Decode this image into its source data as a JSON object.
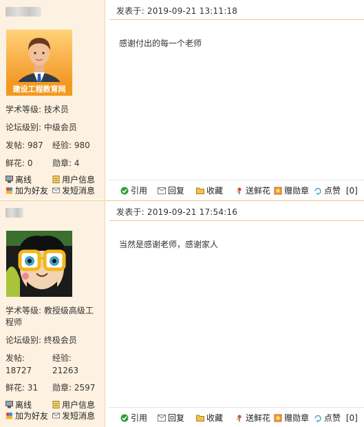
{
  "posts": [
    {
      "username": "",
      "avatar": {
        "caption": "建设工程教育网",
        "icon": "business-man-avatar"
      },
      "title_line": "学术等级: 技术员",
      "forum_level": "论坛级别: 中级会员",
      "posts_label": "发帖:",
      "posts_value": "987",
      "exp_label": "经验:",
      "exp_value": "980",
      "flowers_label": "鲜花:",
      "flowers_value": "0",
      "medals_label": "勋章:",
      "medals_value": "4",
      "links": {
        "status": "离线",
        "profile": "用户信息",
        "add_friend": "加为好友",
        "message": "发短消息"
      },
      "time_label": "发表于:",
      "time_value": "2019-09-21 13:11:18",
      "body": "感谢付出的每一个老师",
      "actions": {
        "quote": "引用",
        "reply": "回复",
        "favorite": "收藏",
        "flowers": "送鲜花",
        "medal": "赠勋章",
        "like": "点赞",
        "like_count": "[0]"
      }
    },
    {
      "username": "",
      "avatar": {
        "caption": "",
        "icon": "cartoon-glasses-avatar"
      },
      "title_line_1": "学术等级: 教授级高级工",
      "title_line_2": "程师",
      "forum_level": "论坛级别: 终极会员",
      "posts_label": "发帖:",
      "posts_value": "18727",
      "exp_label": "经验:",
      "exp_value": "21263",
      "flowers_label": "鲜花:",
      "flowers_value": "31",
      "medals_label": "勋章:",
      "medals_value": "2597",
      "links": {
        "status": "离线",
        "profile": "用户信息",
        "add_friend": "加为好友",
        "message": "发短消息"
      },
      "time_label": "发表于:",
      "time_value": "2019-09-21 17:54:16",
      "body": "当然是感谢老师，感谢家人",
      "actions": {
        "quote": "引用",
        "reply": "回复",
        "favorite": "收藏",
        "flowers": "送鲜花",
        "medal": "赠勋章",
        "like": "点赞",
        "like_count": "[0]"
      }
    }
  ],
  "colors": {
    "sidebar_bg": "#fdf2e1",
    "border": "#f0c890",
    "avatar_orange": "#f39a1e"
  }
}
